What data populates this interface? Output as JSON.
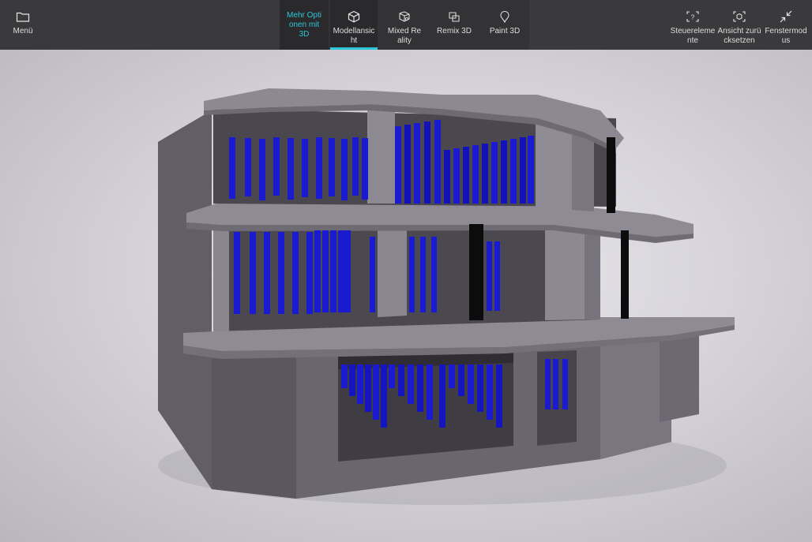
{
  "toolbar": {
    "menu": {
      "label": "Menü",
      "icon": "folder-icon"
    },
    "more_options": {
      "label": "Mehr Optionen mit 3D",
      "color": "#2cc6d8"
    },
    "model_view": {
      "label": "Modellansicht",
      "icon": "cube-icon",
      "selected": true
    },
    "mixed_reality": {
      "label": "Mixed Reality",
      "icon": "mixed-reality-icon"
    },
    "remix3d": {
      "label": "Remix 3D",
      "icon": "remix3d-icon"
    },
    "paint3d": {
      "label": "Paint 3D",
      "icon": "paint3d-icon"
    },
    "controls": {
      "label": "Steuerelemente",
      "icon": "controls-icon"
    },
    "reset_view": {
      "label": "Ansicht zurücksetzen",
      "icon": "reset-view-icon"
    },
    "window_mode": {
      "label": "Fenstermodus",
      "icon": "window-mode-icon"
    }
  },
  "colors": {
    "toolbar_bg": "#3a3a3c",
    "accent": "#2cc6d8",
    "building_gray": "#6e6a73",
    "glass_blue": "#1a1ad0"
  }
}
